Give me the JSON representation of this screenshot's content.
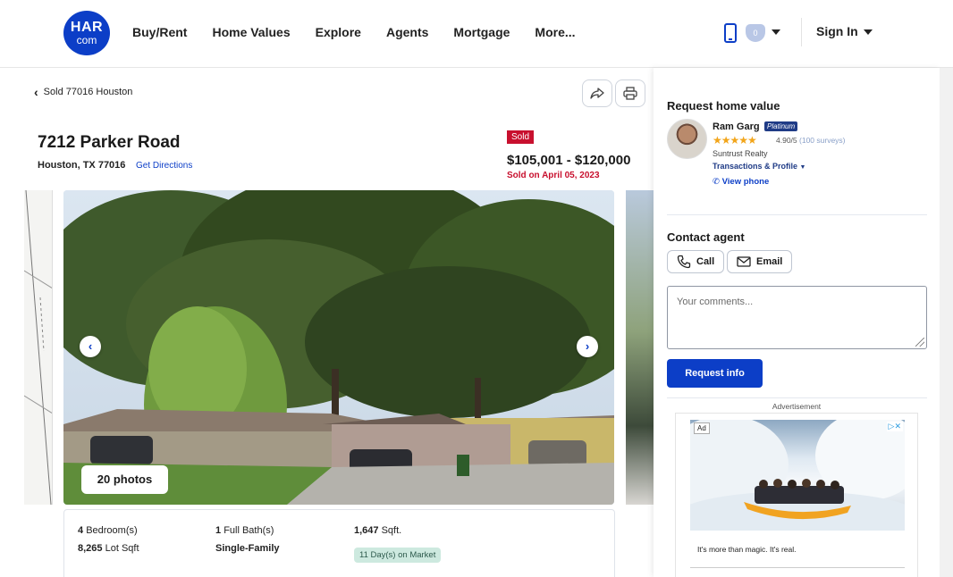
{
  "header": {
    "logo_top": "HAR",
    "logo_bottom": "com",
    "nav": [
      "Buy/Rent",
      "Home Values",
      "Explore",
      "Agents",
      "Mortgage",
      "More..."
    ],
    "favorites_count": "0",
    "sign_in": "Sign In",
    "accent_color": "#0c3ec7"
  },
  "breadcrumb": {
    "back_label": "Sold 77016 Houston"
  },
  "listing": {
    "address": "7212 Parker Road",
    "city_state_zip": "Houston, TX 77016",
    "directions_label": "Get Directions",
    "status_badge": "Sold",
    "price_range": "$105,001 - $120,000",
    "sold_date": "Sold on April 05, 2023",
    "photos_label": "20 photos",
    "facts": {
      "bedrooms_value": "4",
      "bedrooms_label": "Bedroom(s)",
      "baths_value": "1",
      "baths_label": "Full Bath(s)",
      "sqft_value": "1,647",
      "sqft_label": "Sqft.",
      "lot_value": "8,265",
      "lot_label": "Lot Sqft",
      "property_type": "Single-Family",
      "days_on_market": "11 Day(s) on Market"
    }
  },
  "sidebar": {
    "request_value_title": "Request home value",
    "agent": {
      "name": "Ram Garg",
      "badge": "Platinum",
      "stars": "★★★★★",
      "rating": "4.90/5",
      "surveys": "(100 surveys)",
      "brokerage": "Suntrust Realty",
      "profile_link": "Transactions & Profile",
      "phone_link": "View phone"
    },
    "contact_title": "Contact agent",
    "call_label": "Call",
    "email_label": "Email",
    "comments_placeholder": "Your comments...",
    "request_button": "Request info",
    "advertisement_label": "Advertisement",
    "ad": {
      "tag": "Ad",
      "choices": "▷✕",
      "tagline": "It's more than magic. It's real."
    }
  }
}
